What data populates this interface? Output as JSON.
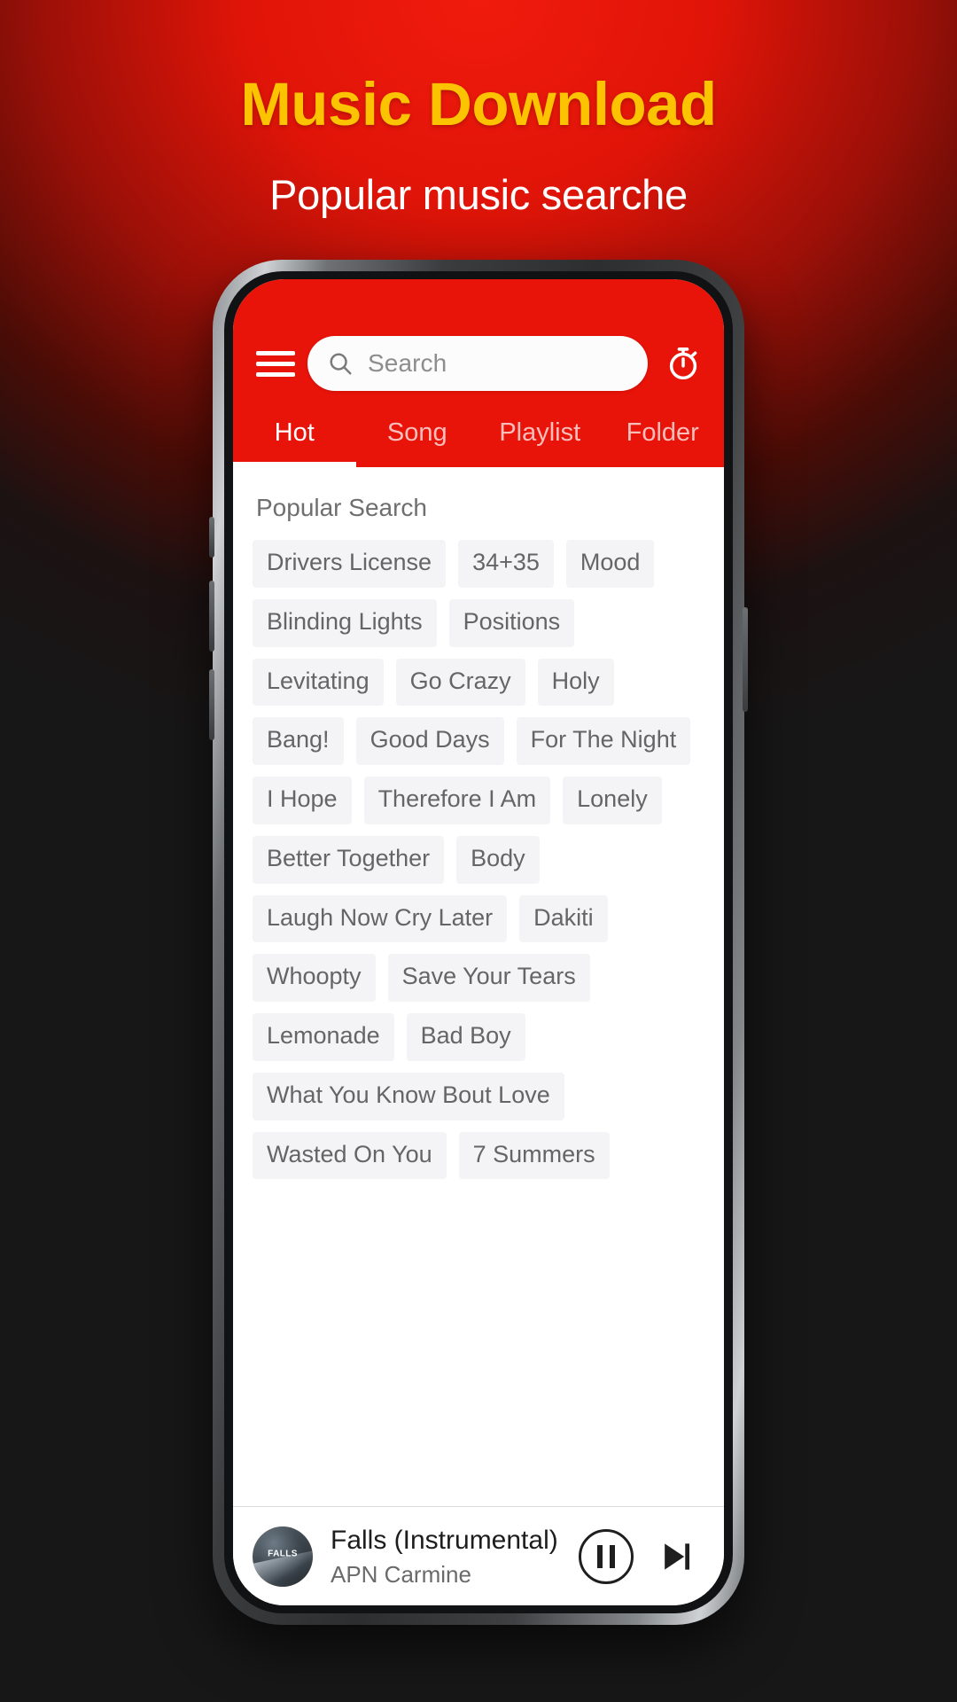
{
  "promo": {
    "title": "Music Download",
    "subtitle": "Popular music searche",
    "title_color": "#fcc400",
    "subtitle_color": "#ffffff",
    "background_accent": "#e01408"
  },
  "app": {
    "accent_color": "#e81309",
    "topbar": {
      "menu_icon": "hamburger-menu-icon",
      "search": {
        "icon": "search-icon",
        "value": "",
        "placeholder": "Search"
      },
      "timer_icon": "stopwatch-timer-icon"
    },
    "tabs": [
      {
        "label": "Hot",
        "active": true
      },
      {
        "label": "Song",
        "active": false
      },
      {
        "label": "Playlist",
        "active": false
      },
      {
        "label": "Folder",
        "active": false
      }
    ],
    "content": {
      "section_title": "Popular Search",
      "chips": [
        "Drivers License",
        "34+35",
        "Mood",
        "Blinding Lights",
        "Positions",
        "Levitating",
        "Go Crazy",
        "Holy",
        "Bang!",
        "Good Days",
        "For The Night",
        "I Hope",
        "Therefore I Am",
        "Lonely",
        "Better Together",
        "Body",
        "Laugh Now Cry Later",
        "Dakiti",
        "Whoopty",
        "Save Your Tears",
        "Lemonade",
        "Bad Boy",
        "What You Know Bout Love",
        "Wasted On You",
        "7 Summers"
      ]
    },
    "player": {
      "album_art_label": "FALLS",
      "track_title": "Falls (Instrumental)",
      "track_artist": "APN Carmine",
      "pause_icon": "pause-icon",
      "next_icon": "next-track-icon"
    }
  }
}
